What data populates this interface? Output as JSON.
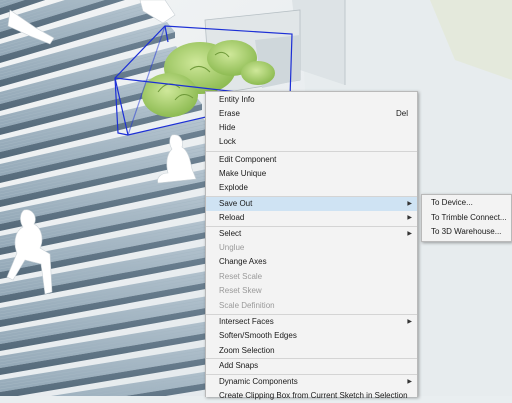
{
  "context_menu": {
    "items": [
      {
        "label": "Entity Info"
      },
      {
        "label": "Erase",
        "shortcut": "Del"
      },
      {
        "label": "Hide"
      },
      {
        "label": "Lock"
      },
      {
        "label": "Edit Component"
      },
      {
        "label": "Make Unique"
      },
      {
        "label": "Explode"
      },
      {
        "label": "Save Out"
      },
      {
        "label": "Reload"
      },
      {
        "label": "Select"
      },
      {
        "label": "Unglue"
      },
      {
        "label": "Change Axes"
      },
      {
        "label": "Reset Scale"
      },
      {
        "label": "Reset Skew"
      },
      {
        "label": "Scale Definition"
      },
      {
        "label": "Intersect Faces"
      },
      {
        "label": "Soften/Smooth Edges"
      },
      {
        "label": "Zoom Selection"
      },
      {
        "label": "Add Snaps"
      },
      {
        "label": "Dynamic Components"
      },
      {
        "label": "Create Clipping Box from Current Sketch in Selection"
      }
    ]
  },
  "submenu": {
    "items": [
      {
        "label": "To Device..."
      },
      {
        "label": "To Trimble Connect..."
      },
      {
        "label": "To 3D Warehouse..."
      }
    ]
  },
  "colors": {
    "menu_bg": "#f3f3f3",
    "highlight": "#cfe3f3",
    "selection_box": "#1c2fd6",
    "stair_steel": "#8fa5b6",
    "plant_green": "#a9cf6a"
  }
}
